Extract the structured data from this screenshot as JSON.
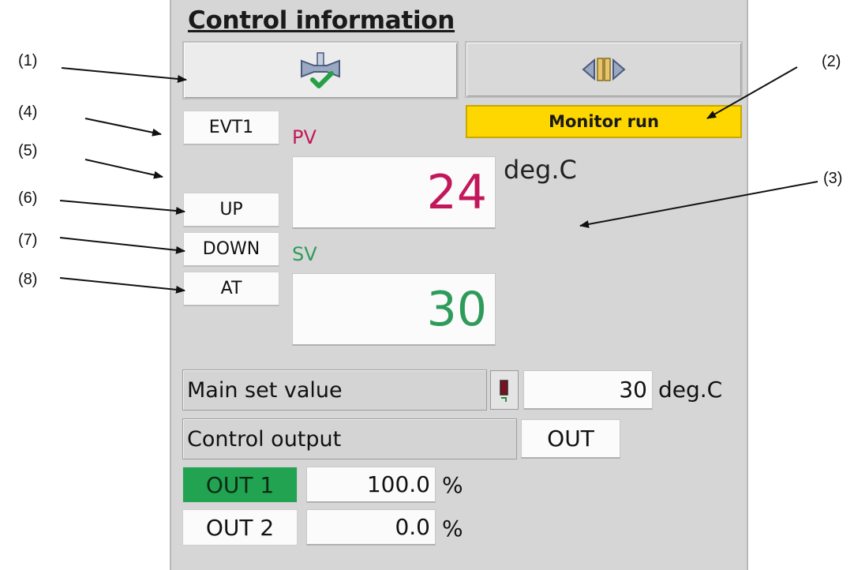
{
  "panel": {
    "title": "Control information",
    "status": "Monitor run",
    "evt": "EVT1",
    "up": "UP",
    "down": "DOWN",
    "at": "AT",
    "pv": {
      "label": "PV",
      "value": "24",
      "unit": "deg.C"
    },
    "sv": {
      "label": "SV",
      "value": "30"
    },
    "main_set": {
      "label": "Main set value",
      "value": "30",
      "unit": "deg.C"
    },
    "control_output": {
      "label": "Control output",
      "value": "OUT"
    },
    "out1": {
      "label": "OUT 1",
      "value": "100.0",
      "unit": "%"
    },
    "out2": {
      "label": "OUT 2",
      "value": "0.0",
      "unit": "%"
    },
    "colors": {
      "pv": "#c2185b",
      "sv": "#2e9b5a",
      "status_bg": "#ffd700",
      "out1_bg": "#21a351"
    },
    "icons": {
      "left_button": "valve-check-icon",
      "right_button": "valve-open-icon",
      "edit_button": "edit-icon"
    }
  },
  "callouts": [
    "(1)",
    "(2)",
    "(3)",
    "(4)",
    "(5)",
    "(6)",
    "(7)",
    "(8)"
  ]
}
